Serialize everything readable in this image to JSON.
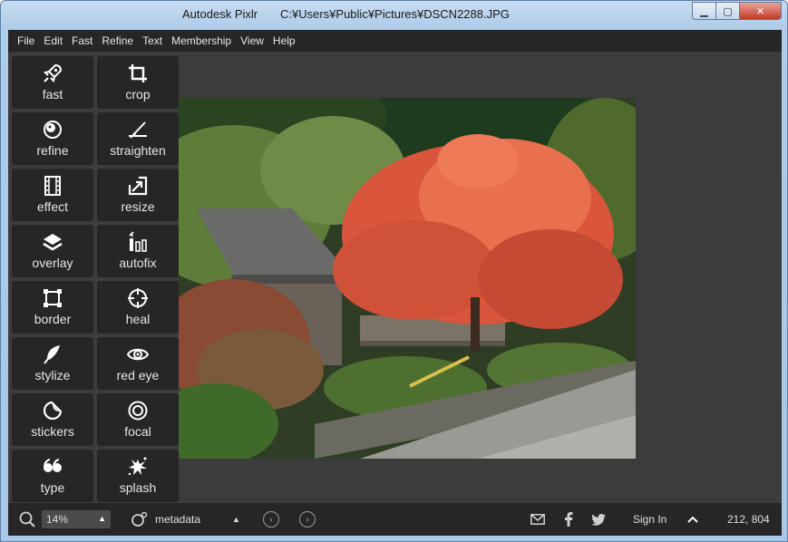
{
  "window": {
    "app_name": "Autodesk Pixlr",
    "file_path": "C:¥Users¥Public¥Pictures¥DSCN2288.JPG",
    "controls": {
      "minimize": "▁",
      "maximize": "▢",
      "close": "✕"
    }
  },
  "menu": [
    "File",
    "Edit",
    "Fast",
    "Refine",
    "Text",
    "Membership",
    "View",
    "Help"
  ],
  "tools": [
    {
      "label": "fast",
      "icon": "rocket-icon"
    },
    {
      "label": "crop",
      "icon": "crop-icon"
    },
    {
      "label": "refine",
      "icon": "refine-icon"
    },
    {
      "label": "straighten",
      "icon": "straighten-icon"
    },
    {
      "label": "effect",
      "icon": "film-icon"
    },
    {
      "label": "resize",
      "icon": "resize-icon"
    },
    {
      "label": "overlay",
      "icon": "layers-icon"
    },
    {
      "label": "autofix",
      "icon": "autofix-icon"
    },
    {
      "label": "border",
      "icon": "border-icon"
    },
    {
      "label": "heal",
      "icon": "crosshair-icon"
    },
    {
      "label": "stylize",
      "icon": "feather-icon"
    },
    {
      "label": "red eye",
      "icon": "eye-icon"
    },
    {
      "label": "stickers",
      "icon": "sticker-icon"
    },
    {
      "label": "focal",
      "icon": "focal-icon"
    },
    {
      "label": "type",
      "icon": "quote-icon"
    },
    {
      "label": "splash",
      "icon": "splash-icon"
    }
  ],
  "status": {
    "zoom": "14%",
    "metadata_label": "metadata",
    "sign_in": "Sign In",
    "coordinates": "212, 804"
  },
  "colors": {
    "app_bg": "#3c3c3c",
    "panel": "#262626",
    "foliage_red": "#e0664a"
  }
}
